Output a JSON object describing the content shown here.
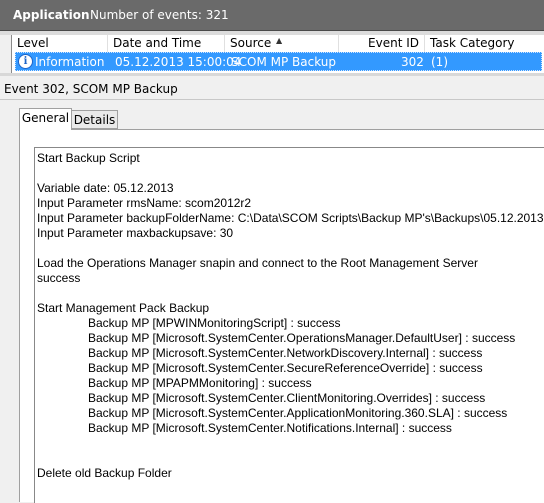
{
  "header": {
    "log_name": "Application",
    "events_label": "Number of events: 321"
  },
  "grid": {
    "columns": [
      "Level",
      "Date and Time",
      "Source",
      "Event ID",
      "Task Category"
    ],
    "row": {
      "level": "Information",
      "datetime": "05.12.2013 15:00:04",
      "source": "SCOM MP Backup",
      "event_id": "302",
      "category": "(1)"
    }
  },
  "event_title": "Event 302, SCOM MP Backup",
  "tabs": [
    "General",
    "Details"
  ],
  "description": [
    "Start Backup Script",
    "Variable date: 05.12.2013",
    "Input Parameter rmsName: scom2012r2",
    "Input Parameter backupFolderName: C:\\Data\\SCOM Scripts\\Backup MP's\\Backups\\05.12.2013",
    "Input Parameter maxbackupsave: 30",
    "Load the Operations Manager snapin and connect to the Root Management Server",
    "success",
    "Start Management Pack Backup",
    "Backup MP [MPWINMonitoringScript] : success",
    "Backup MP [Microsoft.SystemCenter.OperationsManager.DefaultUser] : success",
    "Backup MP [Microsoft.SystemCenter.NetworkDiscovery.Internal] : success",
    "Backup MP [Microsoft.SystemCenter.SecureReferenceOverride] : success",
    "Backup MP [MPAPMMonitoring] : success",
    "Backup MP [Microsoft.SystemCenter.ClientMonitoring.Overrides] : success",
    "Backup MP [Microsoft.SystemCenter.ApplicationMonitoring.360.SLA] : success",
    "Backup MP [Microsoft.SystemCenter.Notifications.Internal] : success",
    "Delete old Backup Folder"
  ],
  "icons": {
    "level": "info-icon",
    "sort": "sort-ascending-icon"
  },
  "colors": {
    "selection": "#3399ff",
    "titlebar": "#6a6a6a"
  }
}
